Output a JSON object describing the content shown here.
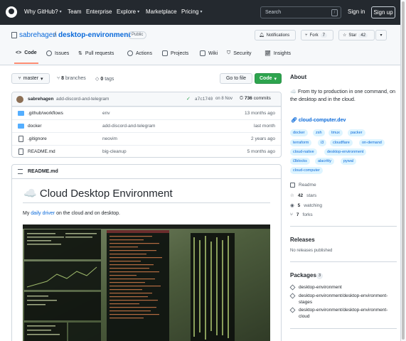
{
  "nav": {
    "items": [
      {
        "label": "Why GitHub?",
        "dropdown": true
      },
      {
        "label": "Team",
        "dropdown": false
      },
      {
        "label": "Enterprise",
        "dropdown": false
      },
      {
        "label": "Explore",
        "dropdown": true
      },
      {
        "label": "Marketplace",
        "dropdown": false
      },
      {
        "label": "Pricing",
        "dropdown": true
      }
    ],
    "search_placeholder": "Search",
    "search_shortcut": "/",
    "signin": "Sign in",
    "signup": "Sign up"
  },
  "repo": {
    "owner": "sabrehagen",
    "separator": "/",
    "name": "desktop-environment",
    "visibility": "Public",
    "notifications_label": "Notifications",
    "fork_label": "Fork",
    "fork_count": "7",
    "star_label": "Star",
    "star_count": "42"
  },
  "tabs": [
    "Code",
    "Issues",
    "Pull requests",
    "Actions",
    "Projects",
    "Wiki",
    "Security",
    "Insights"
  ],
  "toolbar": {
    "branch": "master",
    "branches_count": "8",
    "branches_label": "branches",
    "tags_count": "0",
    "tags_label": "tags",
    "goto_file": "Go to file",
    "code_button": "Code"
  },
  "latest_commit": {
    "author": "sabrehagen",
    "message": "add-discord-and-telegram",
    "check": "✓",
    "sha": "a7c1740",
    "date": "on 8 Nov",
    "commits_count": "736",
    "commits_label": "commits"
  },
  "files": [
    {
      "type": "dir",
      "name": ".github/workflows",
      "message": "env",
      "age": "13 months ago"
    },
    {
      "type": "dir",
      "name": "docker",
      "message": "add-discord-and-telegram",
      "age": "last month"
    },
    {
      "type": "file",
      "name": ".gitignore",
      "message": "neovim",
      "age": "2 years ago"
    },
    {
      "type": "file",
      "name": "README.md",
      "message": "big-cleanup",
      "age": "5 months ago"
    }
  ],
  "readme": {
    "header": "README.md",
    "emoji": "☁️",
    "title": "Cloud Desktop Environment",
    "text_before": "My ",
    "link": "daily driver",
    "text_after": " on the cloud and on desktop."
  },
  "about": {
    "heading": "About",
    "description": "☁️ From tty to production in one command, on the desktop and in the cloud.",
    "website": "cloud-computer.dev",
    "topics": [
      "docker",
      "zsh",
      "tmux",
      "packer",
      "terraform",
      "i3",
      "cloudflare",
      "on-demand",
      "cloud-native",
      "desktop-environment",
      "i3blocks",
      "alacritty",
      "pywal",
      "cloud-computer"
    ],
    "readme_label": "Readme",
    "stars_count": "42",
    "stars_label": "stars",
    "watching_count": "5",
    "watching_label": "watching",
    "forks_count": "7",
    "forks_label": "forks"
  },
  "releases": {
    "heading": "Releases",
    "empty": "No releases published"
  },
  "packages": {
    "heading": "Packages",
    "count": "3",
    "items": [
      "desktop-environment",
      "desktop-environment/desktop-environment-stages",
      "desktop-environment/desktop-environment-cloud"
    ]
  }
}
